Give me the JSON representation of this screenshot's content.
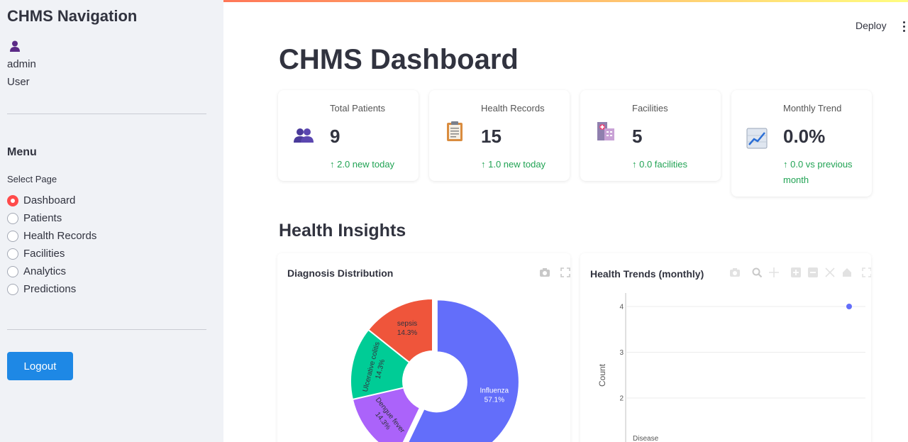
{
  "sidebar": {
    "title": "CHMS Navigation",
    "user_icon": "user-icon",
    "username": "admin",
    "role": "User",
    "menu_heading": "Menu",
    "select_label": "Select Page",
    "pages": [
      {
        "label": "Dashboard",
        "selected": true
      },
      {
        "label": "Patients",
        "selected": false
      },
      {
        "label": "Health Records",
        "selected": false
      },
      {
        "label": "Facilities",
        "selected": false
      },
      {
        "label": "Analytics",
        "selected": false
      },
      {
        "label": "Predictions",
        "selected": false
      }
    ],
    "logout_label": "Logout"
  },
  "header": {
    "deploy_label": "Deploy",
    "menu_icon": "kebab-menu-icon"
  },
  "main": {
    "title": "CHMS Dashboard",
    "metrics": [
      {
        "label": "Total Patients",
        "value": "9",
        "delta": "↑ 2.0 new today",
        "icon": "users-icon"
      },
      {
        "label": "Health Records",
        "value": "15",
        "delta": "↑ 1.0 new today",
        "icon": "clipboard-icon"
      },
      {
        "label": "Facilities",
        "value": "5",
        "delta": "↑ 0.0 facilities",
        "icon": "hospital-icon"
      },
      {
        "label": "Monthly Trend",
        "value": "0.0%",
        "delta": "↑ 0.0 vs previous month",
        "icon": "chart-trend-icon"
      }
    ],
    "insights_title": "Health Insights"
  },
  "colors": {
    "accent": "#ff4b4b",
    "button": "#1e88e5",
    "delta": "#21a354"
  },
  "chart_data": [
    {
      "type": "pie",
      "title": "Diagnosis Distribution",
      "hole": true,
      "slices": [
        {
          "label": "Influenza",
          "value": 57.1,
          "text": "57.1%",
          "color": "#636efa"
        },
        {
          "label": "Dengue fever",
          "value": 14.3,
          "text": "14.3%",
          "color": "#ab63fa"
        },
        {
          "label": "Ulcerative colitis",
          "value": 14.3,
          "text": "14.3%",
          "color": "#00cc96"
        },
        {
          "label": "sepsis",
          "value": 14.3,
          "text": "14.3%",
          "color": "#ef553b"
        }
      ]
    },
    {
      "type": "scatter",
      "title": "Health Trends (monthly)",
      "ylabel": "Count",
      "yticks": [
        "4",
        "3",
        "2"
      ],
      "legend_title": "Disease",
      "points": [
        {
          "y": 4
        }
      ]
    }
  ]
}
